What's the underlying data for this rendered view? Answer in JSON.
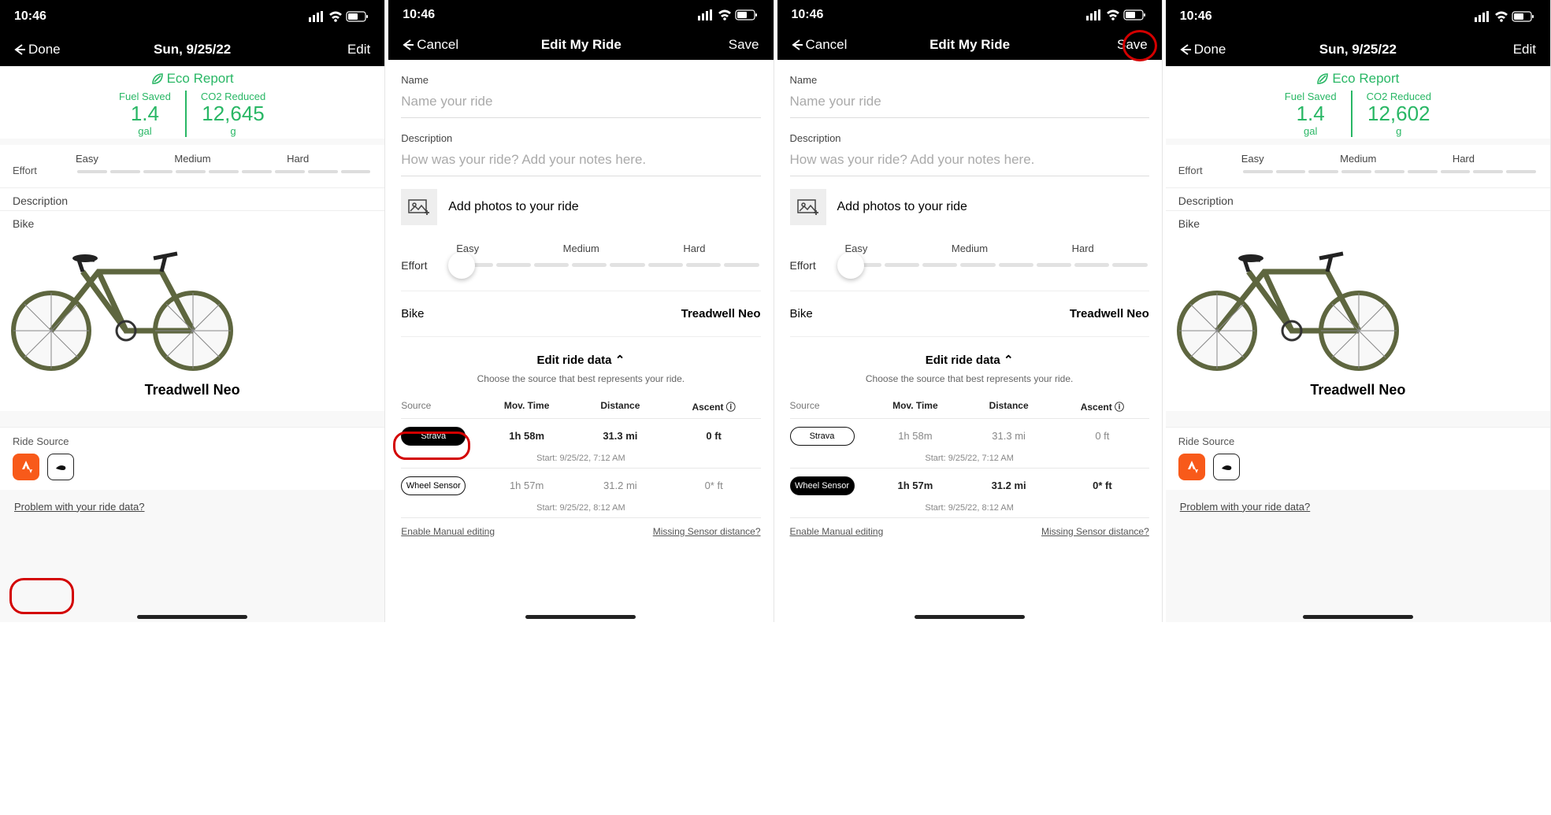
{
  "statusbar": {
    "time": "10:46"
  },
  "screen1": {
    "nav_back": "Done",
    "nav_title": "Sun, 9/25/22",
    "nav_edit": "Edit",
    "eco_title": "Eco Report",
    "fuel_label": "Fuel Saved",
    "fuel_val": "1.4",
    "fuel_unit": "gal",
    "co2_label": "CO2 Reduced",
    "co2_val": "12,645",
    "co2_unit": "g",
    "effort_easy": "Easy",
    "effort_med": "Medium",
    "effort_hard": "Hard",
    "effort_word": "Effort",
    "desc_label": "Description",
    "bike_label": "Bike",
    "bike_name": "Treadwell Neo",
    "ridesrc_label": "Ride Source",
    "problem_link": "Problem with your ride data?"
  },
  "edit": {
    "nav_back": "Cancel",
    "nav_title": "Edit My Ride",
    "nav_save": "Save",
    "name_label": "Name",
    "name_ph": "Name your ride",
    "desc_label": "Description",
    "desc_ph": "How was your ride? Add your notes here.",
    "photo_text": "Add photos to your ride",
    "effort_easy": "Easy",
    "effort_med": "Medium",
    "effort_hard": "Hard",
    "effort_word": "Effort",
    "bike_label": "Bike",
    "bike_value": "Treadwell Neo",
    "edit_data": "Edit ride data",
    "choose_text": "Choose the source that best represents your ride.",
    "col_src": "Source",
    "col_mov": "Mov. Time",
    "col_dist": "Distance",
    "col_asc": "Ascent",
    "strava_name": "Strava",
    "strava_mov": "1h 58m",
    "strava_dist": "31.3 mi",
    "strava_asc": "0 ft",
    "strava_start": "Start: 9/25/22, 7:12 AM",
    "wheel_name": "Wheel Sensor",
    "wheel_mov": "1h 57m",
    "wheel_dist": "31.2 mi",
    "wheel_asc": "0* ft",
    "wheel_start": "Start: 9/25/22, 8:12 AM",
    "manual_link": "Enable Manual editing",
    "missing_link": "Missing Sensor distance?"
  },
  "screen4": {
    "nav_back": "Done",
    "nav_title": "Sun, 9/25/22",
    "nav_edit": "Edit",
    "eco_title": "Eco Report",
    "fuel_label": "Fuel Saved",
    "fuel_val": "1.4",
    "fuel_unit": "gal",
    "co2_label": "CO2 Reduced",
    "co2_val": "12,602",
    "co2_unit": "g",
    "effort_easy": "Easy",
    "effort_med": "Medium",
    "effort_hard": "Hard",
    "effort_word": "Effort",
    "desc_label": "Description",
    "bike_label": "Bike",
    "bike_name": "Treadwell Neo",
    "ridesrc_label": "Ride Source",
    "problem_link": "Problem with your ride data?"
  },
  "icons": {
    "info": "ⓘ",
    "chevron_up": "⌃"
  }
}
